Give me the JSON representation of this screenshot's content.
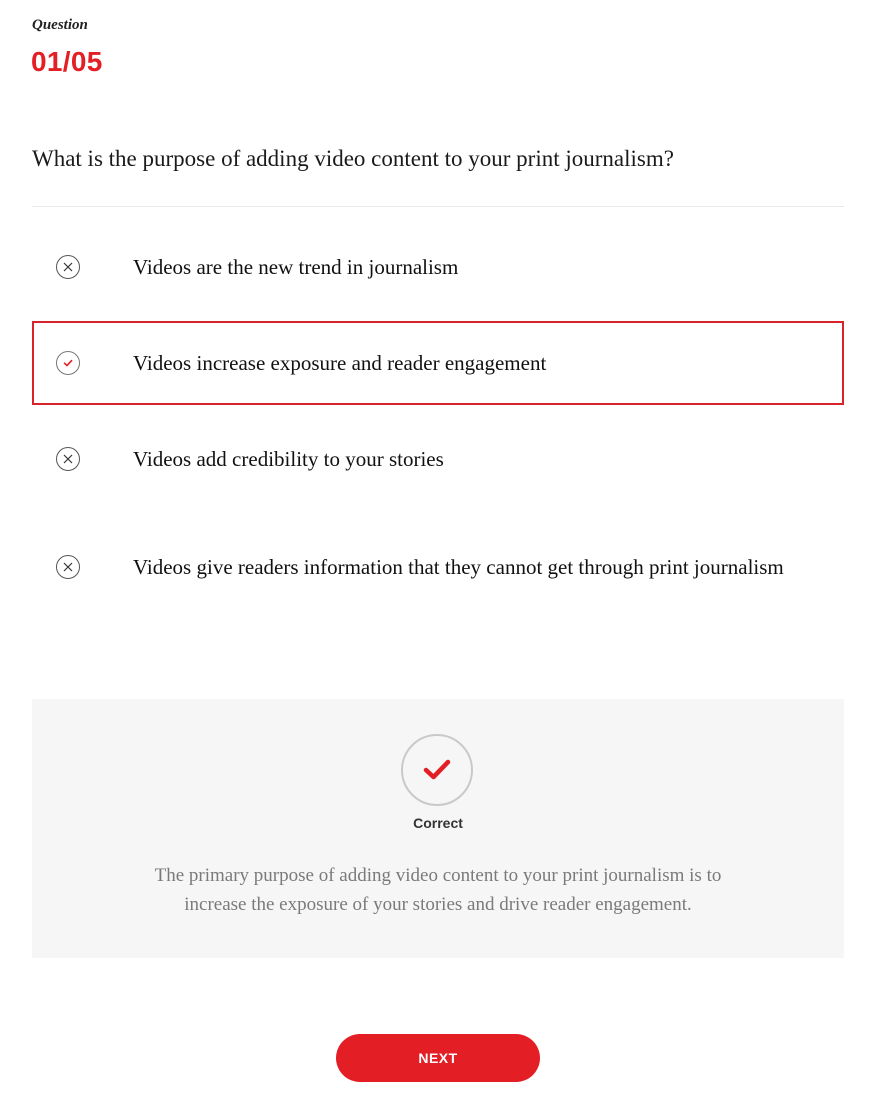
{
  "header": {
    "label": "Question",
    "counter": "01/05"
  },
  "question": {
    "text": "What is the purpose of adding video content to your print journalism?"
  },
  "options": [
    {
      "text": "Videos are the new trend in journalism",
      "state": "incorrect",
      "icon": "x-circle-icon"
    },
    {
      "text": "Videos increase exposure and reader engagement",
      "state": "correct-selected",
      "icon": "check-circle-icon"
    },
    {
      "text": "Videos add credibility to your stories",
      "state": "incorrect",
      "icon": "x-circle-icon"
    },
    {
      "text": "Videos give readers information that they cannot get through print journalism",
      "state": "incorrect",
      "icon": "x-circle-icon"
    }
  ],
  "feedback": {
    "status": "Correct",
    "icon": "check-icon",
    "explanation": "The primary purpose of adding video content to your print journalism is to increase the exposure of your stories and drive reader engagement."
  },
  "actions": {
    "next_label": "NEXT"
  },
  "colors": {
    "accent": "#e31e24",
    "selected_border": "#d8232a",
    "feedback_bg": "#f6f6f6",
    "explanation_text": "#7a7a7a"
  }
}
